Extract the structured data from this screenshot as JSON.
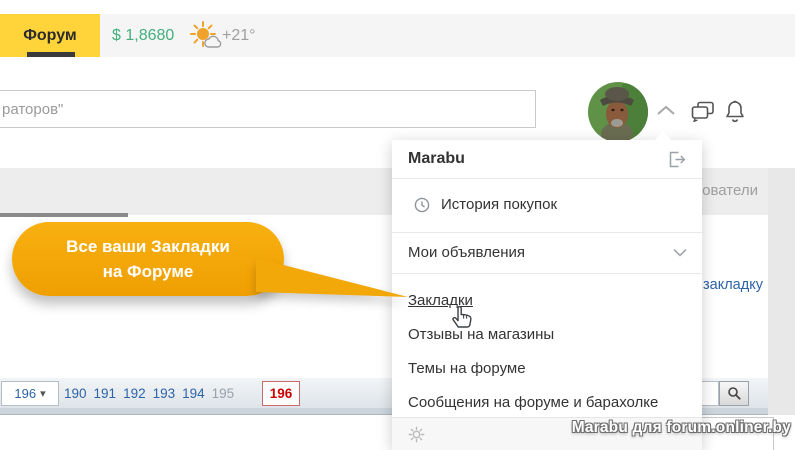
{
  "topbar": {
    "forum_tab": "Форум",
    "currency": "$ 1,8680",
    "temperature": "+21°"
  },
  "header": {
    "search_value": "раторов\""
  },
  "background": {
    "tab_fragment": "ователи",
    "link_fragment": "закладку"
  },
  "tooltip": {
    "line1": "Все ваши Закладки",
    "line2": "на Форуме"
  },
  "dropdown": {
    "username": "Marabu",
    "items": [
      {
        "label": "История покупок"
      },
      {
        "label": "Мои объявления"
      },
      {
        "label": "Закладки"
      },
      {
        "label": "Отзывы на магазины"
      },
      {
        "label": "Темы на форуме"
      },
      {
        "label": "Сообщения на форуме и барахолке"
      }
    ]
  },
  "pagination": {
    "page_select": "196",
    "pages": [
      "190",
      "191",
      "192",
      "193",
      "194"
    ],
    "page_muted": "195",
    "current_page": "196"
  },
  "watermark": "Marabu для forum.onliner.by",
  "icons": {
    "select_caret": "▾"
  },
  "colors": {
    "brand_yellow": "#ffd43b",
    "bubble_orange": "#f6a70b",
    "currency_green": "#44af7b",
    "link_blue": "#2d63a8",
    "current_page_red": "#cc0000"
  }
}
